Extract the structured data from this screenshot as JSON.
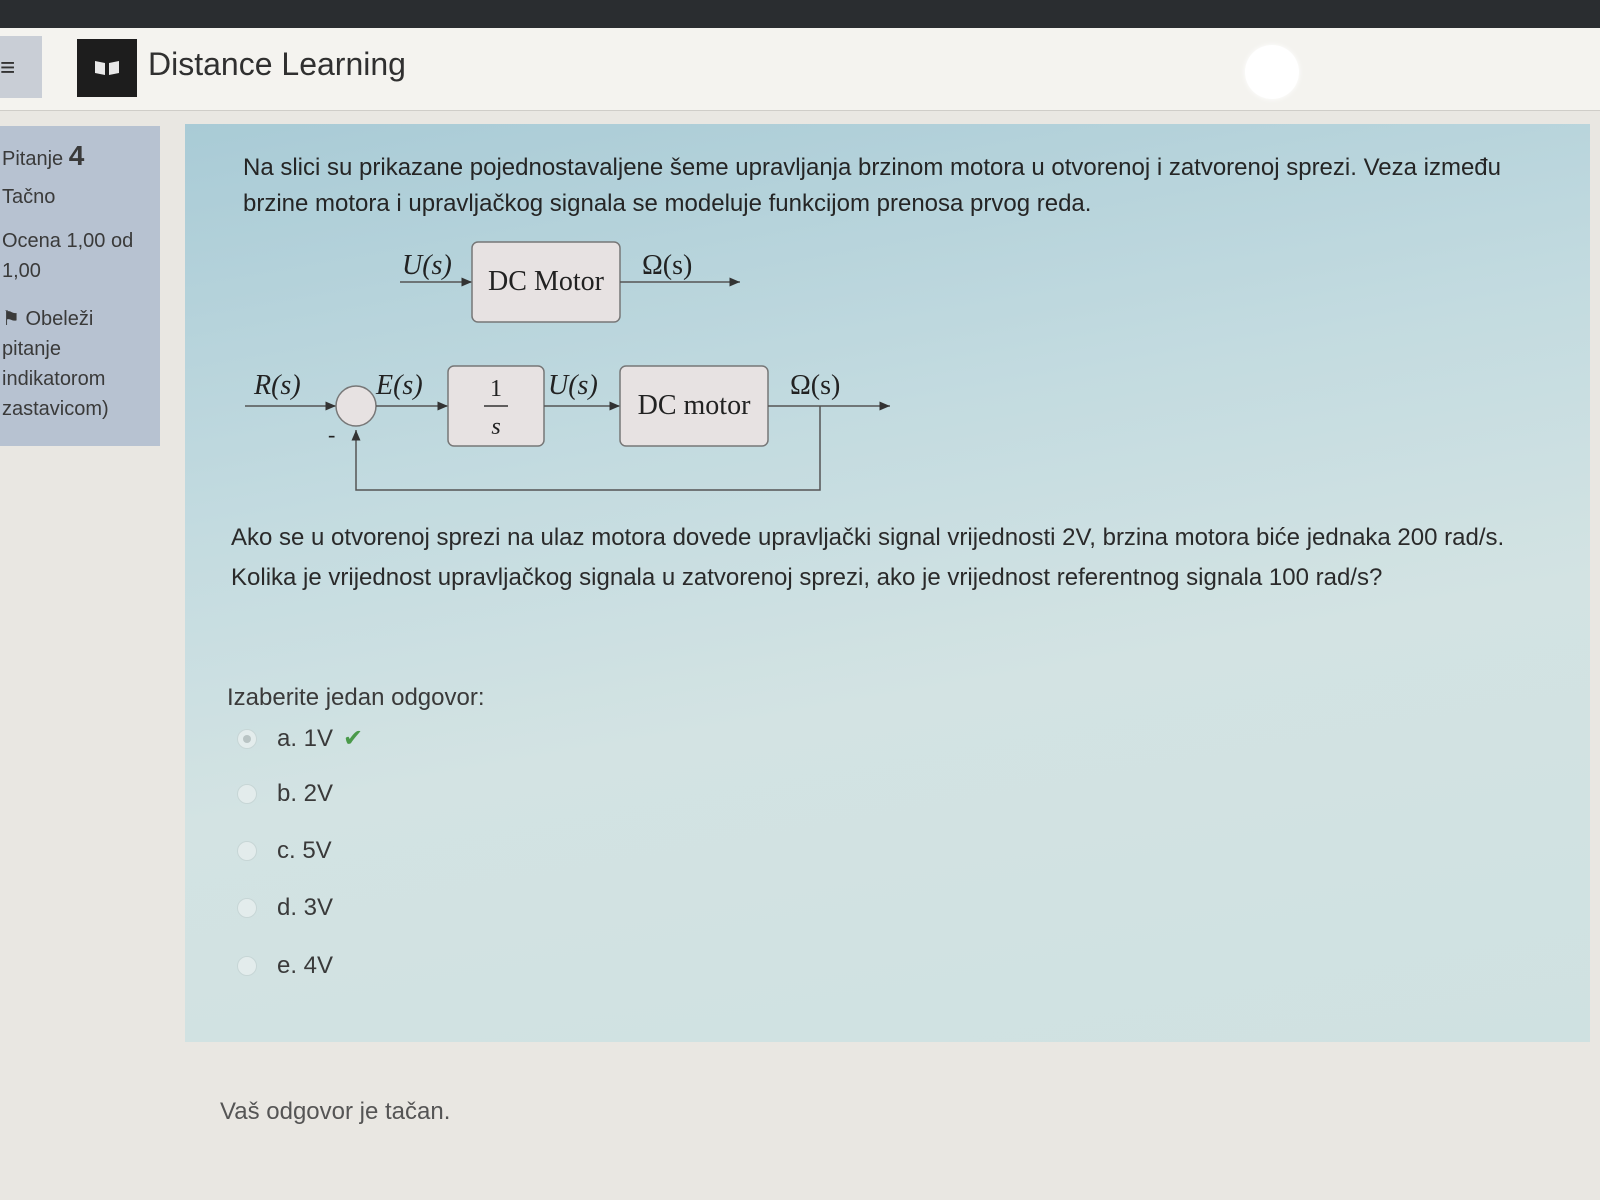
{
  "header": {
    "menu_icon": "hamburger-icon",
    "logo_icon": "book-icon",
    "site_title": "Distance Learning",
    "avatar_icon": "user-avatar"
  },
  "info": {
    "question_label": "Pitanje",
    "question_number": "4",
    "status": "Tačno",
    "grade_line1": "Ocena 1,00 od",
    "grade_line2": "1,00",
    "flag_line1": "Obeleži",
    "flag_line2": "pitanje",
    "flag_line3": "indikatorom",
    "flag_line4": "zastavicom)",
    "flag_icon": "flag-icon"
  },
  "question": {
    "intro": "Na slici su prikazane pojednostavaljene šeme upravljanja brzinom motora u otvorenoj i zatvorenoj sprezi. Veza između brzine motora i upravljačkog signala se modeluje funkcijom prenosa prvog reda.",
    "body": "Ako se u otvorenoj sprezi na ulaz motora dovede upravljački signal vrijednosti 2V, brzina motora biće jednaka 200 rad/s. Kolika je vrijednost upravljačkog signala u zatvorenoj sprezi, ako je vrijednost referentnog signala 100 rad/s?",
    "prompt": "Izaberite jedan odgovor:"
  },
  "diagram": {
    "open_loop": {
      "input_label": "U(s)",
      "block_label": "DC Motor",
      "output_label": "Ω(s)"
    },
    "closed_loop": {
      "ref_label": "R(s)",
      "error_label": "E(s)",
      "integrator_num": "1",
      "integrator_den": "s",
      "control_label": "U(s)",
      "block_label": "DC motor",
      "output_label": "Ω(s)",
      "minus_sign": "-"
    }
  },
  "answers": [
    {
      "label": "a. 1V",
      "selected": true,
      "correct": true
    },
    {
      "label": "b. 2V",
      "selected": false
    },
    {
      "label": "c. 5V",
      "selected": false
    },
    {
      "label": "d. 3V",
      "selected": false
    },
    {
      "label": "e. 4V",
      "selected": false
    }
  ],
  "feedback": "Vaš odgovor je tačan."
}
